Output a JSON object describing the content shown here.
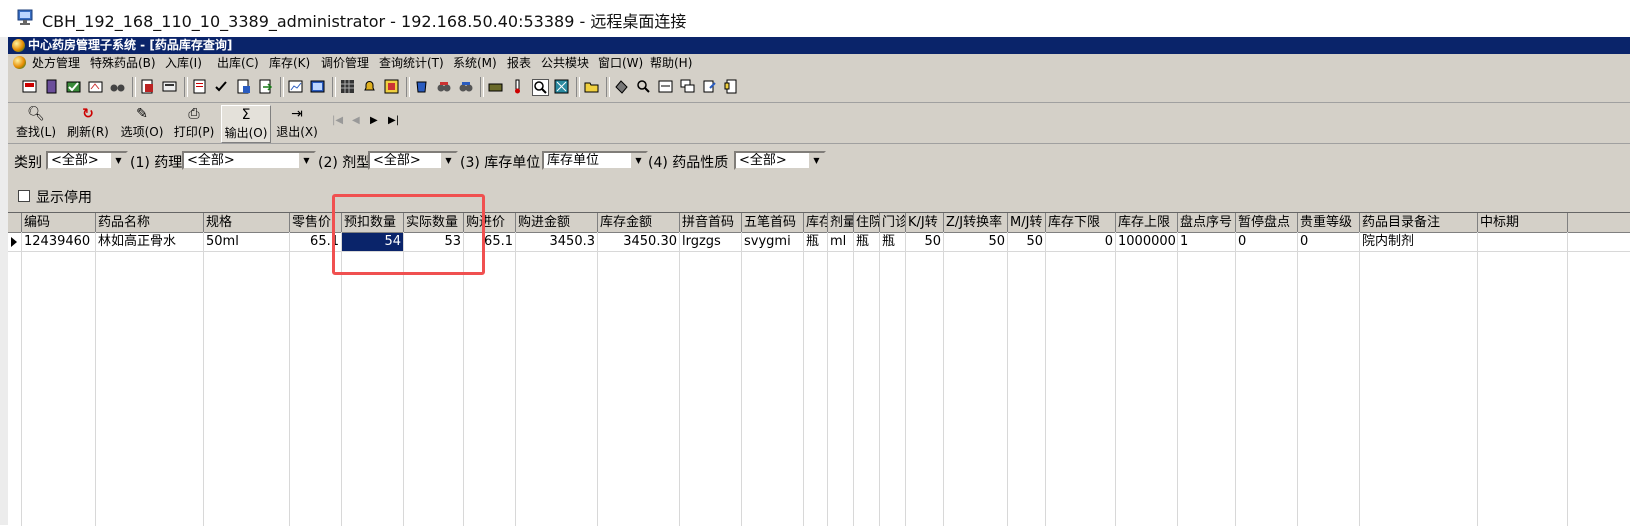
{
  "window": {
    "rdp_title": "CBH_192_168_110_10_3389_administrator - 192.168.50.40:53389 - 远程桌面连接",
    "app_title": "中心药房管理子系统 - [药品库存查询]"
  },
  "menu": [
    "处方管理",
    "特殊药品(B)",
    "入库(I)",
    "出库(C)",
    "库存(K)",
    "调价管理",
    "查询统计(T)",
    "系统(M)",
    "报表",
    "公共模块",
    "窗口(W)",
    "帮助(H)"
  ],
  "toolbar": {
    "find": "查找(L)",
    "refresh": "刷新(R)",
    "options": "选项(O)",
    "print": "打印(P)",
    "output": "输出(O)",
    "exit": "退出(X)"
  },
  "filters": {
    "category_label": "类别",
    "category_value": "<全部>",
    "pharm_label": "(1) 药理",
    "pharm_value": "<全部>",
    "form_label": "(2) 剂型",
    "form_value": "<全部>",
    "unit_label": "(3) 库存单位",
    "unit_value": "库存单位",
    "nature_label": "(4) 药品性质",
    "nature_value": "<全部>"
  },
  "options": {
    "show_disabled_label": "显示停用",
    "show_disabled_checked": false
  },
  "grid": {
    "headers": [
      "编码",
      "药品名称",
      "规格",
      "零售价",
      "预扣数量",
      "实际数量",
      "购进价",
      "购进金额",
      "库存金额",
      "拼音首码",
      "五笔首码",
      "库存",
      "剂量",
      "住院",
      "门诊",
      "K/J转",
      "Z/J转换率",
      "M/J转",
      "库存下限",
      "库存上限",
      "盘点序号",
      "暂停盘点",
      "贵重等级",
      "药品目录备注",
      "中标期"
    ],
    "rows": [
      [
        "12439460",
        "林如高正骨水",
        "50ml",
        "65.1",
        "54",
        "53",
        "65.1",
        "3450.3",
        "3450.30",
        "lrgzgs",
        "svygmi",
        "瓶",
        "ml",
        "瓶",
        "瓶",
        "50",
        "50",
        "50",
        "0",
        "1000000",
        "1",
        "0",
        "0",
        "院内制剂",
        ""
      ]
    ]
  },
  "colors": {
    "titlebar": "#0a246a",
    "face": "#d4d0c8",
    "annotation": "#f05050"
  }
}
